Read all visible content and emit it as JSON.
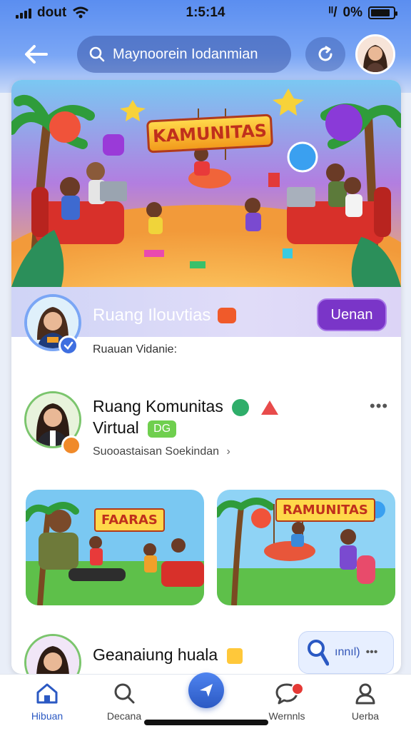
{
  "status_bar": {
    "carrier": "dout",
    "time": "1:5:14",
    "battery": "0%",
    "network": "ᴵᴵ/"
  },
  "header": {
    "search_text": "Maynoorein Iodanmian"
  },
  "banner": {
    "title": "KAMUNITAS"
  },
  "community": {
    "title": "Ruang Ilouvtias",
    "join_label": "Uenan",
    "subtitle": "Ruauan Vidanie:"
  },
  "post": {
    "title_line1": "Ruang Komunitas",
    "title_line2": "Virtual",
    "badge_text": "DG",
    "subtitle": "Suooastaisan Soekindan",
    "more": "•••"
  },
  "thumbnails": [
    {
      "label": "FAARAS"
    },
    {
      "label": "RAMUNITAS"
    }
  ],
  "next_post": {
    "title": "Geanaiung hualа",
    "audio_label": "ınnıl)",
    "more": "•••"
  },
  "nav": {
    "items": [
      {
        "label": "Hibuan"
      },
      {
        "label": "Decana"
      },
      {
        "label": "Wernnls"
      },
      {
        "label": "Uerba"
      }
    ]
  },
  "colors": {
    "accent": "#2b59c3",
    "join": "#7a35c8",
    "header_gradient_top": "#5b8ef0"
  }
}
